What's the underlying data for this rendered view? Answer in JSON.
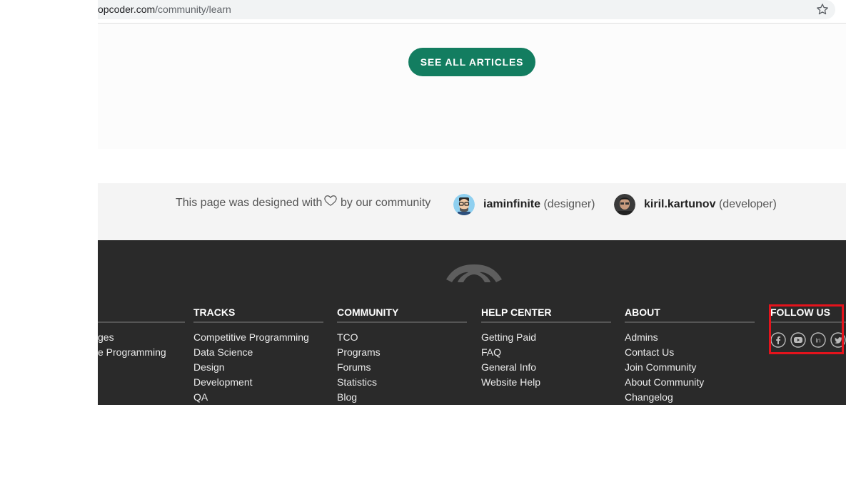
{
  "browser": {
    "url_domain_fragment": "opcoder.com",
    "url_path": "/community/learn",
    "bookmark_icon": "star-icon"
  },
  "content": {
    "see_all_button": "SEE ALL ARTICLES"
  },
  "credits": {
    "text_before": "This page was designed with",
    "heart_icon": "heart-icon",
    "text_after": "by our community",
    "designer": {
      "name": "iaminfinite",
      "role": "(designer)"
    },
    "developer": {
      "name": "kiril.kartunov",
      "role": "(developer)"
    }
  },
  "footer": {
    "logo_icon": "topcoder-logo-icon",
    "columns": [
      {
        "title": "",
        "items": [
          "ges",
          "e Programming"
        ]
      },
      {
        "title": "TRACKS",
        "items": [
          "Competitive Programming",
          "Data Science",
          "Design",
          "Development",
          "QA"
        ]
      },
      {
        "title": "COMMUNITY",
        "items": [
          "TCO",
          "Programs",
          "Forums",
          "Statistics",
          "Blog"
        ]
      },
      {
        "title": "HELP CENTER",
        "items": [
          "Getting Paid",
          "FAQ",
          "General Info",
          "Website Help"
        ]
      },
      {
        "title": "ABOUT",
        "items": [
          "Admins",
          "Contact Us",
          "Join Community",
          "About Community",
          "Changelog"
        ]
      }
    ],
    "follow": {
      "title": "FOLLOW US",
      "icons": [
        "facebook-icon",
        "youtube-icon",
        "linkedin-icon",
        "twitter-icon"
      ]
    }
  },
  "colors": {
    "button_green": "#137d60",
    "footer_bg": "#2a2a2a",
    "highlight_red": "#e4131c"
  }
}
